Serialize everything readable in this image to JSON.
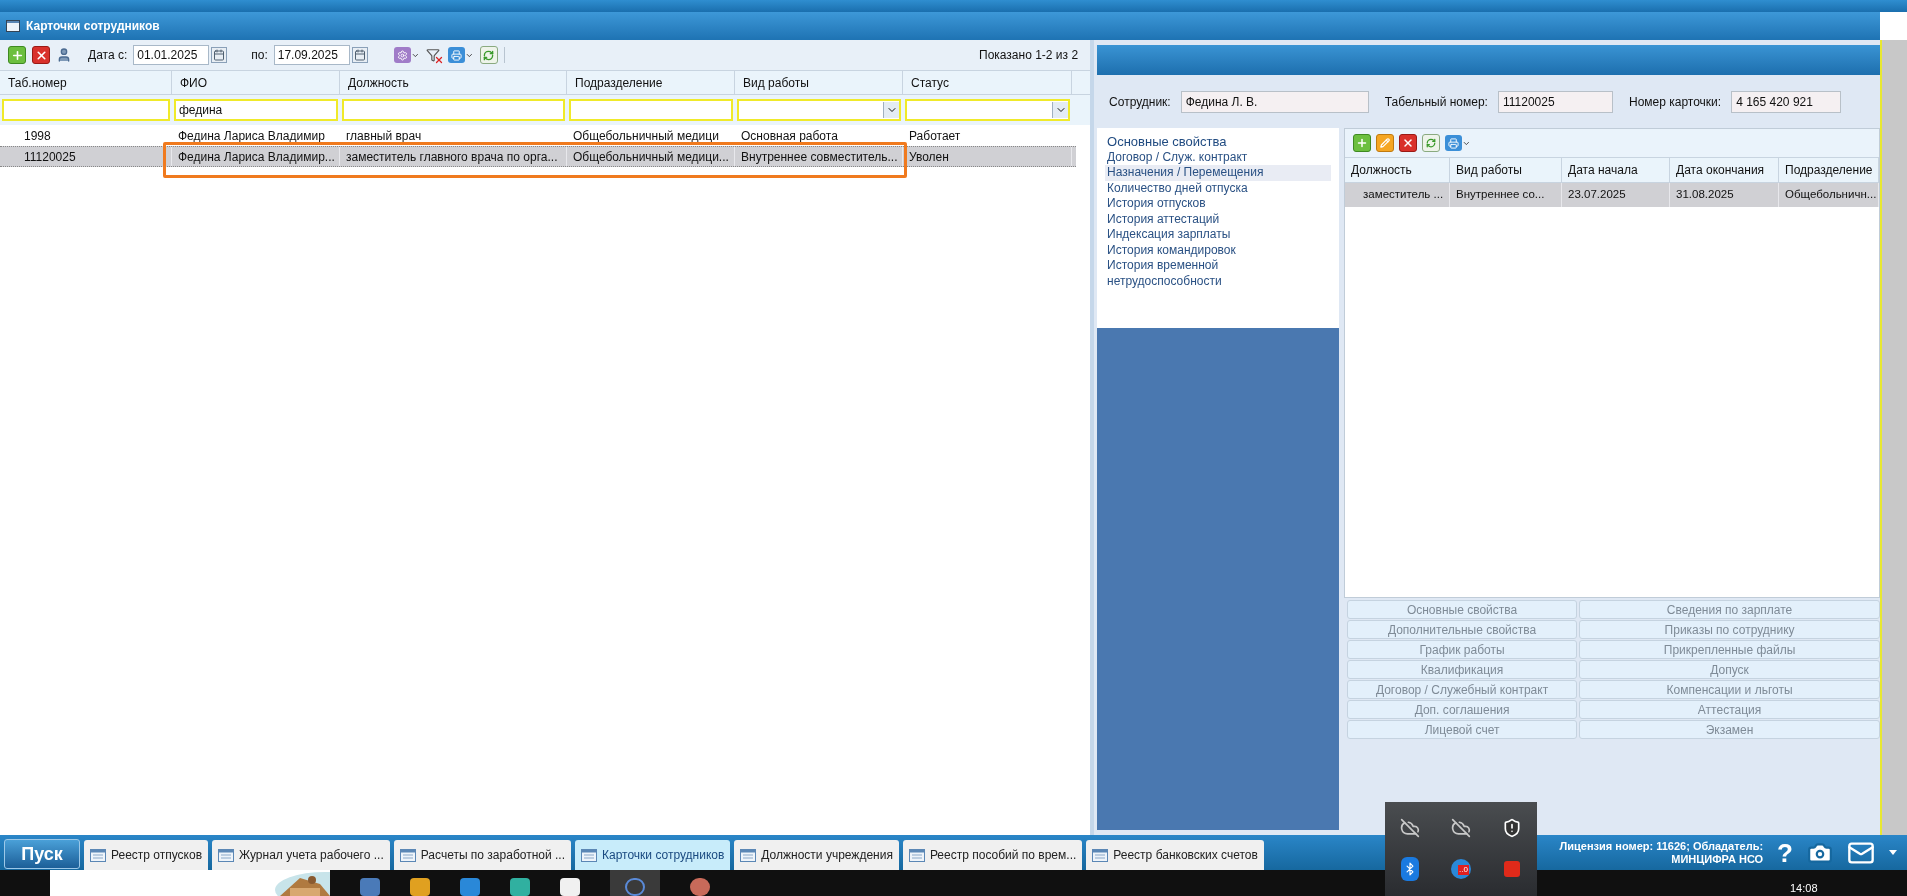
{
  "window": {
    "title": "Карточки сотрудников"
  },
  "toolbar": {
    "date_from_label": "Дата с:",
    "date_from": "01.01.2025",
    "date_to_label": "по:",
    "date_to": "17.09.2025",
    "shown": "Показано 1-2 из 2"
  },
  "table": {
    "columns": [
      {
        "label": "Таб.номер",
        "kind": "text"
      },
      {
        "label": "ФИО",
        "kind": "text",
        "filter_value": "федина"
      },
      {
        "label": "Должность",
        "kind": "text"
      },
      {
        "label": "Подразделение",
        "kind": "text"
      },
      {
        "label": "Вид работы",
        "kind": "select"
      },
      {
        "label": "Статус",
        "kind": "select"
      }
    ],
    "rows": [
      {
        "cells": [
          "1998",
          "Федина Лариса Владимир",
          "главный врач",
          "Общебольничный медици",
          "Основная работа",
          "Работает"
        ],
        "selected": false,
        "annotated": false
      },
      {
        "cells": [
          "11120025",
          "Федина Лариса Владимир...",
          "заместитель главного врача по орга...",
          "Общебольничный медици...",
          "Внутреннее совместитель...",
          "Уволен"
        ],
        "selected": true,
        "annotated": true
      }
    ]
  },
  "employee": {
    "fields": [
      {
        "label": "Сотрудник:",
        "value": "Федина Л. В."
      },
      {
        "label": "Табельный номер:",
        "value": "11120025"
      },
      {
        "label": "Номер карточки:",
        "value": "4 165 420 921"
      }
    ]
  },
  "nav": [
    {
      "label": "Основные свойства",
      "kind": "heading",
      "selected": false
    },
    {
      "label": "Договор / Служ. контракт",
      "kind": "link",
      "selected": false
    },
    {
      "label": "Назначения / Перемещения",
      "kind": "link",
      "selected": true
    },
    {
      "label": "Количество дней отпуска",
      "kind": "link",
      "selected": false
    },
    {
      "label": "История отпусков",
      "kind": "link",
      "selected": false
    },
    {
      "label": "История аттестаций",
      "kind": "link",
      "selected": false
    },
    {
      "label": "Индексация зарплаты",
      "kind": "link",
      "selected": false
    },
    {
      "label": "История командировок",
      "kind": "link",
      "selected": false
    },
    {
      "label": "История временной нетрудоспособности",
      "kind": "link",
      "selected": false
    }
  ],
  "detail_table": {
    "columns": [
      "Должность",
      "Вид работы",
      "Дата начала",
      "Дата окончания",
      "Подразделение"
    ],
    "rows": [
      {
        "cells": [
          "заместитель ...",
          "Внутреннее со...",
          "23.07.2025",
          "31.08.2025",
          "Общебольничн..."
        ],
        "selected": true
      }
    ]
  },
  "section_buttons": [
    {
      "label": "Основные свойства",
      "disabled": true
    },
    {
      "label": "Сведения по зарплате",
      "disabled": true
    },
    {
      "label": "Дополнительные свойства",
      "disabled": true
    },
    {
      "label": "Приказы по сотруднику",
      "disabled": true
    },
    {
      "label": "График работы",
      "disabled": true
    },
    {
      "label": "Прикрепленные файлы",
      "disabled": true
    },
    {
      "label": "Квалификация",
      "disabled": true
    },
    {
      "label": "Допуск",
      "disabled": true
    },
    {
      "label": "Договор / Служебный контракт",
      "disabled": true
    },
    {
      "label": "Компенсации и льготы",
      "disabled": true
    },
    {
      "label": "Доп. соглашения",
      "disabled": true
    },
    {
      "label": "Аттестация",
      "disabled": true
    },
    {
      "label": "Лицевой счет",
      "disabled": true
    },
    {
      "label": "Экзамен",
      "disabled": true
    }
  ],
  "taskbar": {
    "start": "Пуск",
    "tasks": [
      {
        "label": "Реестр отпусков",
        "selected": false
      },
      {
        "label": "Журнал учета рабочего ...",
        "selected": false
      },
      {
        "label": "Расчеты по заработной ...",
        "selected": false
      },
      {
        "label": "Карточки сотрудников",
        "selected": true
      },
      {
        "label": "Должности учреждения",
        "selected": false
      },
      {
        "label": "Реестр пособий по врем...",
        "selected": false
      },
      {
        "label": "Реестр банковских счетов",
        "selected": false
      }
    ],
    "license": [
      "Лицензия номер: 11626; Обладатель:",
      "МИНЦИФРА НСО"
    ],
    "help": "?"
  },
  "tray": {
    "badge": "..0"
  },
  "clock": "14:08"
}
